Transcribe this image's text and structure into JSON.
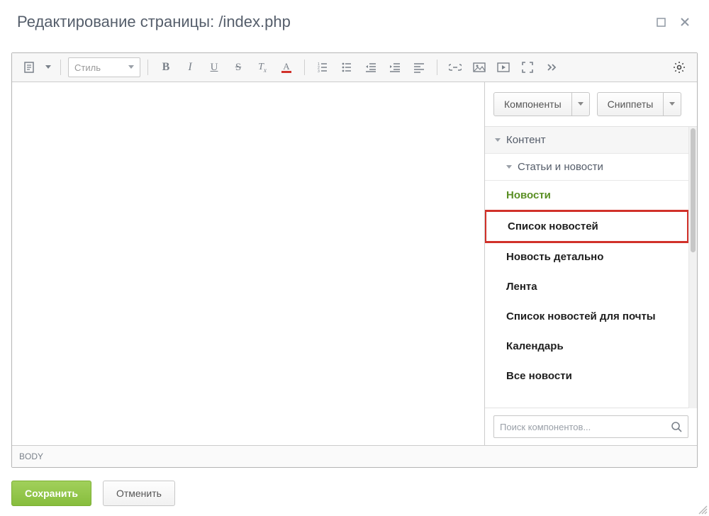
{
  "dialog": {
    "title": "Редактирование страницы: /index.php"
  },
  "toolbar": {
    "style_label": "Стиль"
  },
  "side": {
    "tab_components": "Компоненты",
    "tab_snippets": "Сниппеты",
    "category": "Контент",
    "subcategory": "Статьи и новости",
    "items": [
      {
        "label": "Новости",
        "active": true,
        "highlight": false
      },
      {
        "label": "Список новостей",
        "active": false,
        "highlight": true
      },
      {
        "label": "Новость детально",
        "active": false,
        "highlight": false
      },
      {
        "label": "Лента",
        "active": false,
        "highlight": false
      },
      {
        "label": "Список новостей для почты",
        "active": false,
        "highlight": false
      },
      {
        "label": "Календарь",
        "active": false,
        "highlight": false
      },
      {
        "label": "Все новости",
        "active": false,
        "highlight": false
      }
    ],
    "search_placeholder": "Поиск компонентов..."
  },
  "crumb": "BODY",
  "footer": {
    "save": "Сохранить",
    "cancel": "Отменить"
  }
}
